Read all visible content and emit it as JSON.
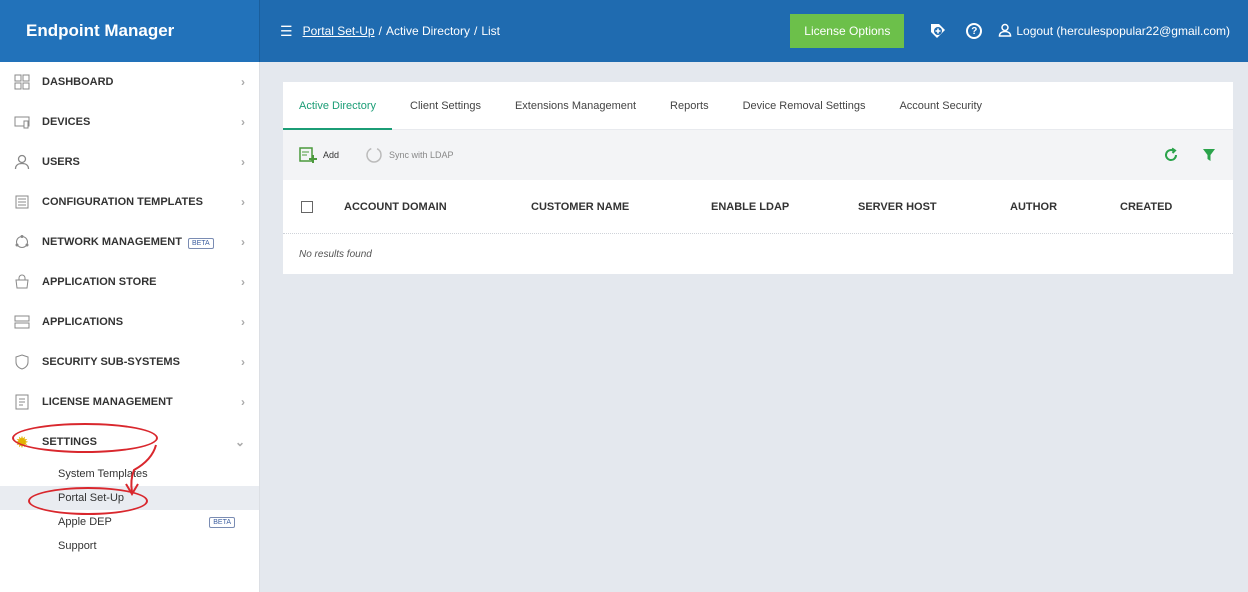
{
  "header": {
    "brand": "Endpoint Manager",
    "breadcrumb": {
      "portal": "Portal Set-Up",
      "sep1": "/",
      "active_directory": "Active Directory",
      "sep2": "/",
      "list": "List"
    },
    "license_button": "License Options",
    "logout": "Logout (herculespopular22@gmail.com)"
  },
  "sidebar": {
    "items": [
      {
        "label": "DASHBOARD",
        "icon": "dashboard-icon"
      },
      {
        "label": "DEVICES",
        "icon": "devices-icon"
      },
      {
        "label": "USERS",
        "icon": "users-icon"
      },
      {
        "label": "CONFIGURATION TEMPLATES",
        "icon": "templates-icon"
      },
      {
        "label": "NETWORK MANAGEMENT",
        "icon": "network-icon",
        "badge": "BETA"
      },
      {
        "label": "APPLICATION STORE",
        "icon": "store-icon"
      },
      {
        "label": "APPLICATIONS",
        "icon": "applications-icon"
      },
      {
        "label": "SECURITY SUB-SYSTEMS",
        "icon": "shield-icon"
      },
      {
        "label": "LICENSE MANAGEMENT",
        "icon": "license-icon"
      },
      {
        "label": "SETTINGS",
        "icon": "gear-icon"
      }
    ],
    "settings_sub": [
      {
        "label": "System Templates"
      },
      {
        "label": "Portal Set-Up"
      },
      {
        "label": "Apple DEP",
        "badge": "BETA"
      },
      {
        "label": "Support"
      }
    ]
  },
  "tabs": [
    {
      "label": "Active Directory"
    },
    {
      "label": "Client Settings"
    },
    {
      "label": "Extensions Management"
    },
    {
      "label": "Reports"
    },
    {
      "label": "Device Removal Settings"
    },
    {
      "label": "Account Security"
    }
  ],
  "toolbar": {
    "add": "Add",
    "sync": "Sync with LDAP"
  },
  "table": {
    "columns": [
      "ACCOUNT DOMAIN",
      "CUSTOMER NAME",
      "ENABLE LDAP",
      "SERVER HOST",
      "AUTHOR",
      "CREATED"
    ],
    "empty_text": "No results found"
  },
  "colors": {
    "header_bg": "#1f6bb0",
    "license_btn": "#6cc04a",
    "active_tab": "#1b9d76",
    "annotation": "#d9272d"
  }
}
